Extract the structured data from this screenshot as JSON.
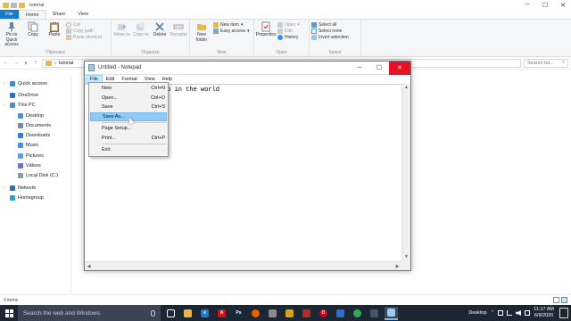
{
  "explorer": {
    "title": "tutorial",
    "tabs": [
      "File",
      "Home",
      "Share",
      "View"
    ],
    "ribbon": {
      "clipboard": {
        "label": "Clipboard",
        "pin": "Pin to Quick access",
        "copy": "Copy",
        "paste": "Paste",
        "cut": "Cut",
        "copy_path": "Copy path",
        "paste_shortcut": "Paste shortcut"
      },
      "organize": {
        "label": "Organize",
        "move_to": "Move to",
        "copy_to": "Copy to",
        "delete": "Delete",
        "rename": "Rename"
      },
      "new": {
        "label": "New",
        "new_folder": "New folder",
        "new_item": "New item",
        "easy_access": "Easy access"
      },
      "open": {
        "label": "Open",
        "properties": "Properties",
        "open": "Open",
        "edit": "Edit",
        "history": "History"
      },
      "select": {
        "label": "Select",
        "select_all": "Select all",
        "select_none": "Select none",
        "invert": "Invert selection"
      }
    },
    "address": {
      "path": "tutorial",
      "search_placeholder": "Search tut..."
    },
    "nav": [
      {
        "label": "Quick access",
        "color": "#3a8ee6"
      },
      {
        "label": "OneDrive",
        "color": "#2a6fd0"
      },
      {
        "label": "This PC",
        "color": "#4f8bc9"
      },
      {
        "label": "Desktop",
        "color": "#4a90d9"
      },
      {
        "label": "Documents",
        "color": "#7a8a9a"
      },
      {
        "label": "Downloads",
        "color": "#2b7dd6"
      },
      {
        "label": "Music",
        "color": "#4a90d9"
      },
      {
        "label": "Pictures",
        "color": "#5aa0e0"
      },
      {
        "label": "Videos",
        "color": "#6b6fd6"
      },
      {
        "label": "Local Disk (C:)",
        "color": "#8a9bb0"
      },
      {
        "label": "Network",
        "color": "#3a6fb0"
      },
      {
        "label": "Homegroup",
        "color": "#2a9fd0"
      }
    ],
    "status": "0 items"
  },
  "notepad": {
    "title": "Untitled - Notepad",
    "menus": [
      "File",
      "Edit",
      "Format",
      "View",
      "Help"
    ],
    "visible_text": "ip in the world",
    "file_menu": [
      {
        "label": "New",
        "shortcut": "Ctrl+N"
      },
      {
        "label": "Open...",
        "shortcut": "Ctrl+O"
      },
      {
        "label": "Save",
        "shortcut": "Ctrl+S"
      },
      {
        "label": "Save As...",
        "shortcut": ""
      },
      {
        "label": "Page Setup...",
        "shortcut": ""
      },
      {
        "label": "Print...",
        "shortcut": "Ctrl+P"
      },
      {
        "label": "Exit",
        "shortcut": ""
      }
    ]
  },
  "taskbar": {
    "search_placeholder": "Search the web and Windows",
    "desktop_label": "Desktop",
    "time": "11:17 AM",
    "date": "6/9/2020",
    "apps": [
      {
        "name": "task-view",
        "color": "#ffffff",
        "glyph": ""
      },
      {
        "name": "file-explorer",
        "color": "#e8b84a",
        "glyph": ""
      },
      {
        "name": "edge",
        "color": "#1e78d7",
        "glyph": "e"
      },
      {
        "name": "acrobat",
        "color": "#c4161c",
        "glyph": "A"
      },
      {
        "name": "photoshop",
        "color": "#0e2a47",
        "glyph": "Ps"
      },
      {
        "name": "firefox",
        "color": "#e66000",
        "glyph": ""
      },
      {
        "name": "photos",
        "color": "#8a8a8a",
        "glyph": ""
      },
      {
        "name": "paint",
        "color": "#d6a419",
        "glyph": ""
      },
      {
        "name": "app-red",
        "color": "#b52b27",
        "glyph": ""
      },
      {
        "name": "opera",
        "color": "#d0021b",
        "glyph": "O"
      },
      {
        "name": "edge-2",
        "color": "#2b6fd6",
        "glyph": ""
      },
      {
        "name": "chrome",
        "color": "#34a853",
        "glyph": ""
      },
      {
        "name": "app-gray",
        "color": "#4a5563",
        "glyph": ""
      },
      {
        "name": "notepad",
        "color": "#9ec8ef",
        "glyph": ""
      }
    ]
  }
}
